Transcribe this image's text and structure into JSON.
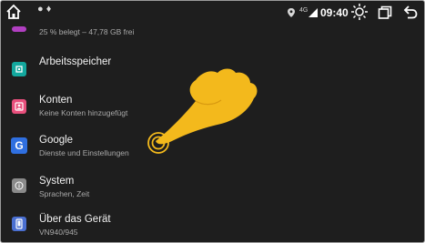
{
  "status_bar": {
    "network": "4G",
    "time": "09:40",
    "icons": [
      "home-icon",
      "notification-dots",
      "location-icon",
      "signal-icon",
      "brightness-icon",
      "recents-icon",
      "back-icon"
    ]
  },
  "settings": {
    "storage_sub": "25 % belegt – 47,78 GB frei",
    "items": [
      {
        "title": "Arbeitsspeicher",
        "subtitle": "",
        "icon": "memory-icon",
        "color": "#13a89e"
      },
      {
        "title": "Konten",
        "subtitle": "Keine Konten hinzugefügt",
        "icon": "accounts-icon",
        "color": "#e84f7c"
      },
      {
        "title": "Google",
        "subtitle": "Dienste und Einstellungen",
        "icon": "google-icon",
        "color": "#2f6fe0",
        "letter": "G"
      },
      {
        "title": "System",
        "subtitle": "Sprachen, Zeit",
        "icon": "info-icon",
        "color": "#8a8a8a"
      },
      {
        "title": "Über das Gerät",
        "subtitle": "VN940/945",
        "icon": "phone-icon",
        "color": "#4a6fd1"
      }
    ]
  },
  "colors": {
    "background": "#1e1e1e",
    "storage_icon": "#b13fc1",
    "hand": "#f3b91c",
    "tap_ring": "#f3b91c"
  }
}
